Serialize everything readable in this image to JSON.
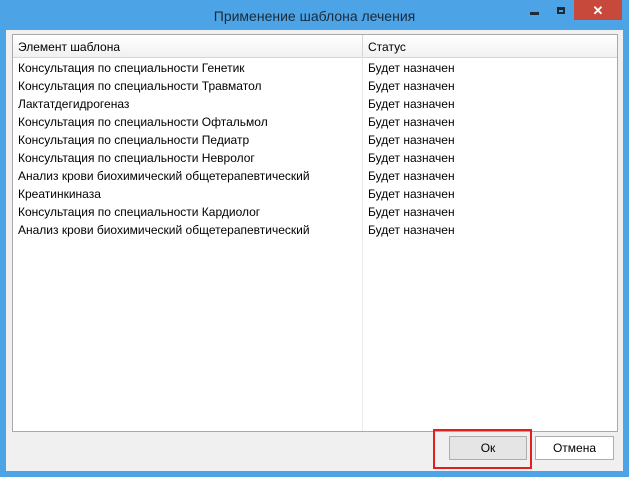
{
  "window": {
    "title": "Применение шаблона лечения"
  },
  "table": {
    "headers": [
      "Элемент шаблона",
      "Статус"
    ],
    "rows": [
      [
        "Консультация по специальности Генетик",
        "Будет назначен"
      ],
      [
        "Консультация по специальности Травматол",
        "Будет назначен"
      ],
      [
        "Лактатдегидрогеназ",
        "Будет назначен"
      ],
      [
        "Консультация по специальности Офтальмол",
        "Будет назначен"
      ],
      [
        "Консультация по специальности Педиатр",
        "Будет назначен"
      ],
      [
        "Консультация по специальности Невролог",
        "Будет назначен"
      ],
      [
        "Анализ крови биохимический общетерапевтический",
        "Будет назначен"
      ],
      [
        "Креатинкиназа",
        "Будет назначен"
      ],
      [
        "Консультация по специальности Кардиолог",
        "Будет назначен"
      ],
      [
        "Анализ крови биохимический общетерапевтический",
        "Будет назначен"
      ]
    ]
  },
  "buttons": {
    "ok": "Ок",
    "cancel": "Отмена"
  },
  "icons": {
    "minimize": "minimize-icon",
    "maximize": "maximize-icon",
    "close": "close-icon"
  },
  "colors": {
    "titlebar": "#4ca3e6",
    "close": "#c7493b",
    "highlight": "#e02020"
  }
}
